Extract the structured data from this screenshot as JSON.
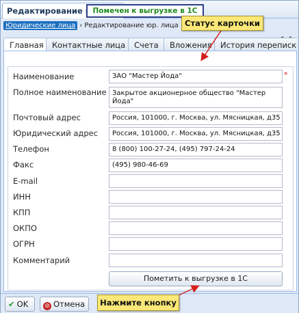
{
  "doc_tab": {
    "title": "Редактирование юр. лица",
    "close_glyph": "×"
  },
  "breadcrumb": {
    "link": "Юридические лица",
    "separator": "›",
    "current": "Редактирование юр. лица"
  },
  "nav_arrows": "◀ ▶",
  "tabs": [
    "Главная",
    "Контактные лица",
    "Счета",
    "Вложения",
    "История переписки"
  ],
  "status": {
    "text": "Помечен к выгрузке в 1С",
    "color": "#1f8a1f"
  },
  "fields": {
    "name": {
      "label": "Наименование",
      "value": "ЗАО \"Мастер Йода\"",
      "required_mark": "*"
    },
    "full_name": {
      "label": "Полное наименование",
      "value": "Закрытое акционерное общество \"Мастер Йода\""
    },
    "postal_address": {
      "label": "Почтовый адрес",
      "value": "Россия, 101000, г. Москва, ул. Мясницкая, д35"
    },
    "legal_address": {
      "label": "Юридический адрес",
      "value": "Россия, 101000, г. Москва, ул. Мясницкая, д35"
    },
    "phone": {
      "label": "Телефон",
      "value": "8 (800) 100-27-24, (495) 797-24-24"
    },
    "fax": {
      "label": "Факс",
      "value": "(495) 980-46-69"
    },
    "email": {
      "label": "E-mail",
      "value": ""
    },
    "inn": {
      "label": "ИНН",
      "value": ""
    },
    "kpp": {
      "label": "КПП",
      "value": ""
    },
    "okpo": {
      "label": "ОКПО",
      "value": ""
    },
    "ogrn": {
      "label": "ОГРН",
      "value": ""
    },
    "comment": {
      "label": "Комментарий",
      "value": ""
    }
  },
  "action_button": "Пометить к выгрузке в 1С",
  "callouts": {
    "status": "Статус карточки",
    "press_button": "Нажмите кнопку"
  },
  "buttons": {
    "ok": "OK",
    "cancel": "Отмена"
  },
  "colors": {
    "accent": "#1a6fc0",
    "callout": "#fbe878",
    "status_border": "#2c3d8c",
    "arrow": "#d42020"
  }
}
